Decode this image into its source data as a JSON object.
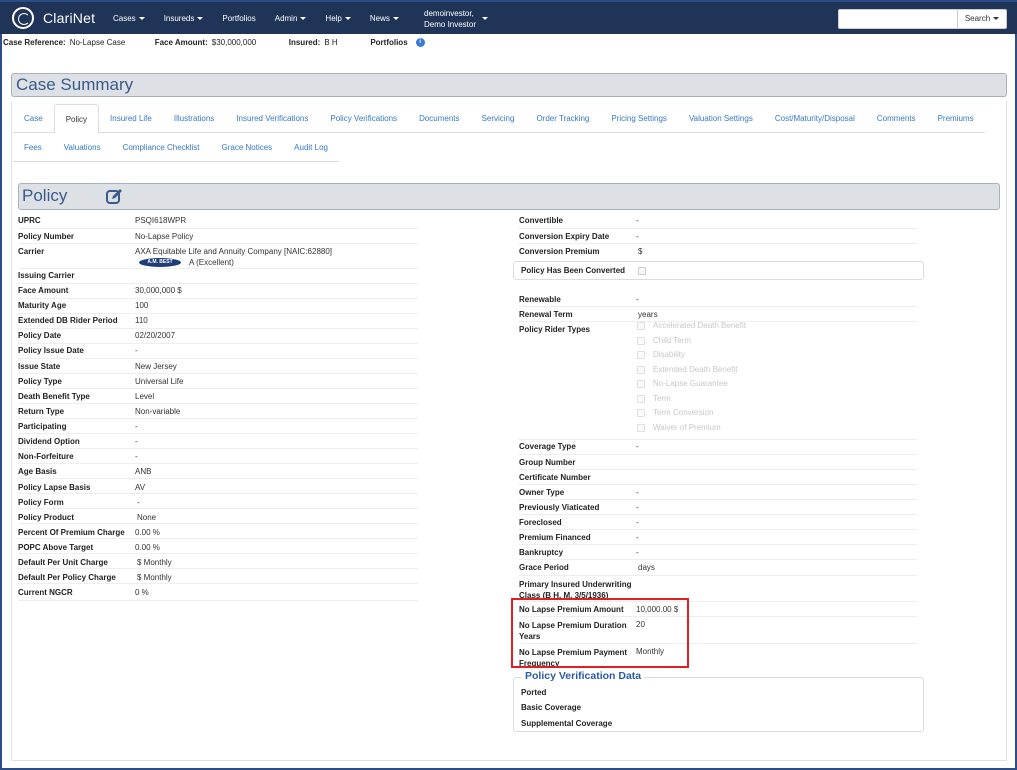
{
  "navbar": {
    "brand": "ClariNet",
    "menu": [
      "Cases",
      "Insureds",
      "Portfolios",
      "Admin",
      "Help",
      "News"
    ],
    "user_line1": "demoinvestor,",
    "user_line2": "Demo Investor",
    "search_placeholder": "",
    "search_button": "Search"
  },
  "infobar": {
    "case_ref_label": "Case Reference:",
    "case_ref_value": "No-Lapse Case",
    "face_label": "Face Amount:",
    "face_value": "$30,000,000",
    "insured_label": "Insured:",
    "insured_value": "B H",
    "portfolios_label": "Portfolios",
    "info_icon_glyph": "i"
  },
  "summary_title": "Case Summary",
  "tabs_row1": [
    "Case",
    "Policy",
    "Insured Life",
    "Illustrations",
    "Insured Verifications",
    "Policy Verifications",
    "Documents",
    "Servicing",
    "Order Tracking",
    "Pricing Settings",
    "Valuation Settings",
    "Cost/Maturity/Disposal",
    "Comments",
    "Premiums"
  ],
  "tabs_row2": [
    "Fees",
    "Valuations",
    "Compliance Checklist",
    "Grace Notices",
    "Audit Log"
  ],
  "active_tab": "Policy",
  "policy_title": "Policy",
  "left_fields": [
    {
      "label": "UPRC",
      "value": "PSQI618WPR"
    },
    {
      "label": "Policy Number",
      "value": "No-Lapse Policy"
    },
    {
      "label": "Carrier",
      "value": "AXA Equitable Life and Annuity Company [NAIC:62880]"
    },
    {
      "label": "Issuing Carrier",
      "value": ""
    },
    {
      "label": "Face Amount",
      "value": "30,000,000 $"
    },
    {
      "label": "Maturity Age",
      "value": "100"
    },
    {
      "label": "Extended DB Rider Period",
      "value": "110"
    },
    {
      "label": "Policy Date",
      "value": "02/20/2007"
    },
    {
      "label": "Policy Issue Date",
      "value": "-"
    },
    {
      "label": "Issue State",
      "value": "New Jersey"
    },
    {
      "label": "Policy Type",
      "value": "Universal Life"
    },
    {
      "label": "Death Benefit Type",
      "value": "Level"
    },
    {
      "label": "Return Type",
      "value": "Non-variable"
    },
    {
      "label": "Participating",
      "value": "-"
    },
    {
      "label": "Dividend Option",
      "value": "-"
    },
    {
      "label": "Non-Forfeiture",
      "value": "-"
    },
    {
      "label": "Age Basis",
      "value": "ANB"
    },
    {
      "label": "Policy Lapse Basis",
      "value": "AV"
    },
    {
      "label": "Policy Form",
      "value": "-"
    },
    {
      "label": "Policy Product",
      "value": "None"
    },
    {
      "label": "Percent Of Premium Charge",
      "value": "0.00 %"
    },
    {
      "label": "POPC Above Target",
      "value": "0.00 %"
    },
    {
      "label": "Default Per Unit Charge",
      "value": "$ Monthly"
    },
    {
      "label": "Default Per Policy Charge",
      "value": "$ Monthly"
    },
    {
      "label": "Current NGCR",
      "value": "0 %"
    }
  ],
  "carrier_rating": {
    "badge": "A.M. BEST",
    "rating": "A (Excellent)"
  },
  "right_fields_top": [
    {
      "label": "Convertible",
      "value": "-"
    },
    {
      "label": "Conversion Expiry Date",
      "value": "-"
    },
    {
      "label": "Conversion Premium",
      "value": "$"
    }
  ],
  "converted_label": "Policy Has Been Converted",
  "right_fields_mid": [
    {
      "label": "Renewable",
      "value": "-"
    },
    {
      "label": "Renewal Term",
      "value": "years"
    },
    {
      "label": "Policy Rider Types",
      "value": ""
    }
  ],
  "rider_types": [
    "Accelerated Death Benefit",
    "Child Term",
    "Disability",
    "Extended Death Benefit",
    "No-Lapse Guarantee",
    "Term",
    "Term Conversion",
    "Waiver of Premium"
  ],
  "right_fields_bottom": [
    {
      "label": "Coverage Type",
      "value": "-"
    },
    {
      "label": "Group Number",
      "value": ""
    },
    {
      "label": "Certificate Number",
      "value": ""
    },
    {
      "label": "Owner Type",
      "value": "-"
    },
    {
      "label": "Previously Viaticated",
      "value": "-"
    },
    {
      "label": "Foreclosed",
      "value": "-"
    },
    {
      "label": "Premium Financed",
      "value": "-"
    },
    {
      "label": "Bankruptcy",
      "value": "-"
    },
    {
      "label": "Grace Period",
      "value": "days"
    }
  ],
  "underwriting": {
    "label_line1": "Primary Insured Underwriting",
    "label_line2": "Class (B H, M, 3/5/1936)",
    "value": ""
  },
  "no_lapse": [
    {
      "label_line1": "No Lapse Premium Amount",
      "label_line2": "",
      "value": "10,000.00 $"
    },
    {
      "label_line1": "No Lapse Premium Duration",
      "label_line2": "Years",
      "value": "20"
    },
    {
      "label_line1": "No Lapse Premium Payment",
      "label_line2": "Frequency",
      "value": "Monthly"
    }
  ],
  "pvd": {
    "title": "Policy Verification Data",
    "rows": [
      "Ported",
      "Basic Coverage",
      "Supplemental Coverage"
    ]
  }
}
